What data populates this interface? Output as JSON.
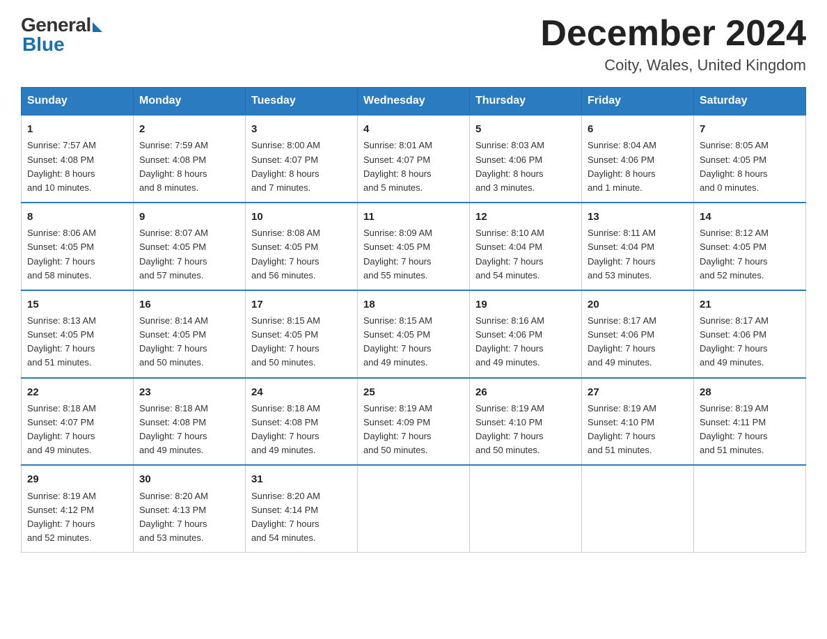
{
  "logo": {
    "general": "General",
    "blue": "Blue"
  },
  "title": "December 2024",
  "location": "Coity, Wales, United Kingdom",
  "days_of_week": [
    "Sunday",
    "Monday",
    "Tuesday",
    "Wednesday",
    "Thursday",
    "Friday",
    "Saturday"
  ],
  "weeks": [
    [
      {
        "day": "1",
        "info": "Sunrise: 7:57 AM\nSunset: 4:08 PM\nDaylight: 8 hours\nand 10 minutes."
      },
      {
        "day": "2",
        "info": "Sunrise: 7:59 AM\nSunset: 4:08 PM\nDaylight: 8 hours\nand 8 minutes."
      },
      {
        "day": "3",
        "info": "Sunrise: 8:00 AM\nSunset: 4:07 PM\nDaylight: 8 hours\nand 7 minutes."
      },
      {
        "day": "4",
        "info": "Sunrise: 8:01 AM\nSunset: 4:07 PM\nDaylight: 8 hours\nand 5 minutes."
      },
      {
        "day": "5",
        "info": "Sunrise: 8:03 AM\nSunset: 4:06 PM\nDaylight: 8 hours\nand 3 minutes."
      },
      {
        "day": "6",
        "info": "Sunrise: 8:04 AM\nSunset: 4:06 PM\nDaylight: 8 hours\nand 1 minute."
      },
      {
        "day": "7",
        "info": "Sunrise: 8:05 AM\nSunset: 4:05 PM\nDaylight: 8 hours\nand 0 minutes."
      }
    ],
    [
      {
        "day": "8",
        "info": "Sunrise: 8:06 AM\nSunset: 4:05 PM\nDaylight: 7 hours\nand 58 minutes."
      },
      {
        "day": "9",
        "info": "Sunrise: 8:07 AM\nSunset: 4:05 PM\nDaylight: 7 hours\nand 57 minutes."
      },
      {
        "day": "10",
        "info": "Sunrise: 8:08 AM\nSunset: 4:05 PM\nDaylight: 7 hours\nand 56 minutes."
      },
      {
        "day": "11",
        "info": "Sunrise: 8:09 AM\nSunset: 4:05 PM\nDaylight: 7 hours\nand 55 minutes."
      },
      {
        "day": "12",
        "info": "Sunrise: 8:10 AM\nSunset: 4:04 PM\nDaylight: 7 hours\nand 54 minutes."
      },
      {
        "day": "13",
        "info": "Sunrise: 8:11 AM\nSunset: 4:04 PM\nDaylight: 7 hours\nand 53 minutes."
      },
      {
        "day": "14",
        "info": "Sunrise: 8:12 AM\nSunset: 4:05 PM\nDaylight: 7 hours\nand 52 minutes."
      }
    ],
    [
      {
        "day": "15",
        "info": "Sunrise: 8:13 AM\nSunset: 4:05 PM\nDaylight: 7 hours\nand 51 minutes."
      },
      {
        "day": "16",
        "info": "Sunrise: 8:14 AM\nSunset: 4:05 PM\nDaylight: 7 hours\nand 50 minutes."
      },
      {
        "day": "17",
        "info": "Sunrise: 8:15 AM\nSunset: 4:05 PM\nDaylight: 7 hours\nand 50 minutes."
      },
      {
        "day": "18",
        "info": "Sunrise: 8:15 AM\nSunset: 4:05 PM\nDaylight: 7 hours\nand 49 minutes."
      },
      {
        "day": "19",
        "info": "Sunrise: 8:16 AM\nSunset: 4:06 PM\nDaylight: 7 hours\nand 49 minutes."
      },
      {
        "day": "20",
        "info": "Sunrise: 8:17 AM\nSunset: 4:06 PM\nDaylight: 7 hours\nand 49 minutes."
      },
      {
        "day": "21",
        "info": "Sunrise: 8:17 AM\nSunset: 4:06 PM\nDaylight: 7 hours\nand 49 minutes."
      }
    ],
    [
      {
        "day": "22",
        "info": "Sunrise: 8:18 AM\nSunset: 4:07 PM\nDaylight: 7 hours\nand 49 minutes."
      },
      {
        "day": "23",
        "info": "Sunrise: 8:18 AM\nSunset: 4:08 PM\nDaylight: 7 hours\nand 49 minutes."
      },
      {
        "day": "24",
        "info": "Sunrise: 8:18 AM\nSunset: 4:08 PM\nDaylight: 7 hours\nand 49 minutes."
      },
      {
        "day": "25",
        "info": "Sunrise: 8:19 AM\nSunset: 4:09 PM\nDaylight: 7 hours\nand 50 minutes."
      },
      {
        "day": "26",
        "info": "Sunrise: 8:19 AM\nSunset: 4:10 PM\nDaylight: 7 hours\nand 50 minutes."
      },
      {
        "day": "27",
        "info": "Sunrise: 8:19 AM\nSunset: 4:10 PM\nDaylight: 7 hours\nand 51 minutes."
      },
      {
        "day": "28",
        "info": "Sunrise: 8:19 AM\nSunset: 4:11 PM\nDaylight: 7 hours\nand 51 minutes."
      }
    ],
    [
      {
        "day": "29",
        "info": "Sunrise: 8:19 AM\nSunset: 4:12 PM\nDaylight: 7 hours\nand 52 minutes."
      },
      {
        "day": "30",
        "info": "Sunrise: 8:20 AM\nSunset: 4:13 PM\nDaylight: 7 hours\nand 53 minutes."
      },
      {
        "day": "31",
        "info": "Sunrise: 8:20 AM\nSunset: 4:14 PM\nDaylight: 7 hours\nand 54 minutes."
      },
      {
        "day": "",
        "info": ""
      },
      {
        "day": "",
        "info": ""
      },
      {
        "day": "",
        "info": ""
      },
      {
        "day": "",
        "info": ""
      }
    ]
  ]
}
